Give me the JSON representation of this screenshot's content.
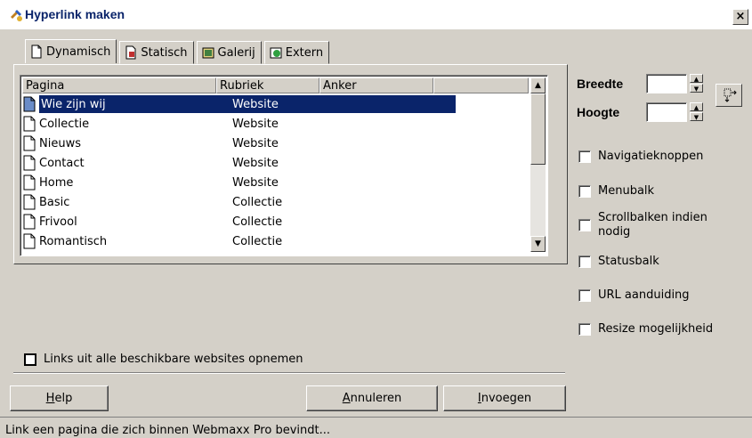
{
  "window": {
    "title": "Hyperlink maken",
    "close_glyph": "×"
  },
  "tabs": [
    {
      "label": "Dynamisch",
      "icon": "page-icon",
      "active": true
    },
    {
      "label": "Statisch",
      "icon": "static-page-icon",
      "active": false
    },
    {
      "label": "Galerij",
      "icon": "gallery-icon",
      "active": false
    },
    {
      "label": "Extern",
      "icon": "external-icon",
      "active": false
    }
  ],
  "table": {
    "columns": [
      "Pagina",
      "Rubriek",
      "Anker"
    ],
    "rows": [
      {
        "pagina": "Wie zijn wij",
        "rubriek": "Website",
        "selected": true
      },
      {
        "pagina": "Collectie",
        "rubriek": "Website"
      },
      {
        "pagina": "Nieuws",
        "rubriek": "Website"
      },
      {
        "pagina": "Contact",
        "rubriek": "Website"
      },
      {
        "pagina": "Home",
        "rubriek": "Website"
      },
      {
        "pagina": "Basic",
        "rubriek": "Collectie"
      },
      {
        "pagina": "Frivool",
        "rubriek": "Collectie"
      },
      {
        "pagina": "Romantisch",
        "rubriek": "Collectie"
      }
    ]
  },
  "include_all_sites_label": "Links uit alle beschikbare websites opnemen",
  "size": {
    "width_label": "Breedte",
    "height_label": "Hoogte",
    "width_value": "",
    "height_value": ""
  },
  "options": [
    {
      "label": "Navigatieknoppen"
    },
    {
      "label": "Menubalk"
    },
    {
      "label": "Scrollbalken indien nodig"
    },
    {
      "label": "Statusbalk"
    },
    {
      "label": "URL aanduiding"
    },
    {
      "label": "Resize mogelijkheid"
    }
  ],
  "buttons": {
    "help": {
      "accel": "H",
      "rest": "elp"
    },
    "cancel": {
      "accel": "A",
      "rest": "nnuleren"
    },
    "insert": {
      "accel": "I",
      "rest": "nvoegen"
    }
  },
  "status_text": "Link een pagina die zich binnen Webmaxx Pro bevindt..."
}
